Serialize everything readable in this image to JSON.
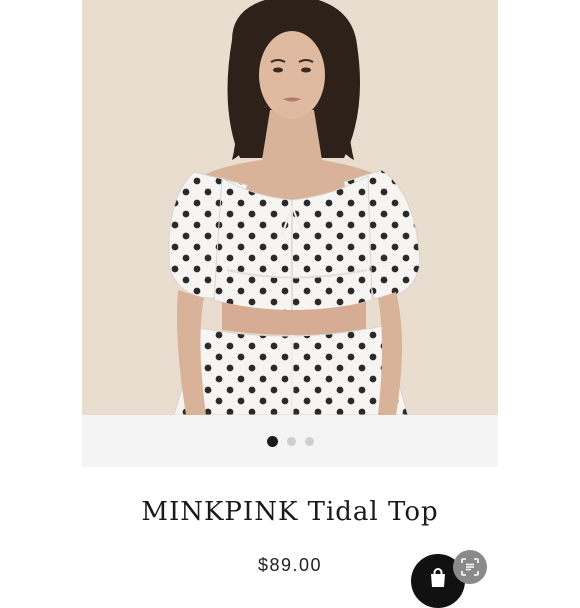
{
  "product": {
    "title": "MINKPINK Tidal Top",
    "price": "$89.00",
    "image_alt": "Model wearing white polka dot crop top with puff sleeves"
  },
  "gallery": {
    "slides": 3,
    "active_index": 0
  },
  "icons": {
    "cart": "shopping-bag-icon",
    "scan": "scan-icon"
  },
  "colors": {
    "image_background": "#e9ddd0",
    "pager_background": "#f4f4f4",
    "active_dot": "#1a1a1a",
    "inactive_dot": "#cfcfcf",
    "cart_button": "#111111"
  }
}
